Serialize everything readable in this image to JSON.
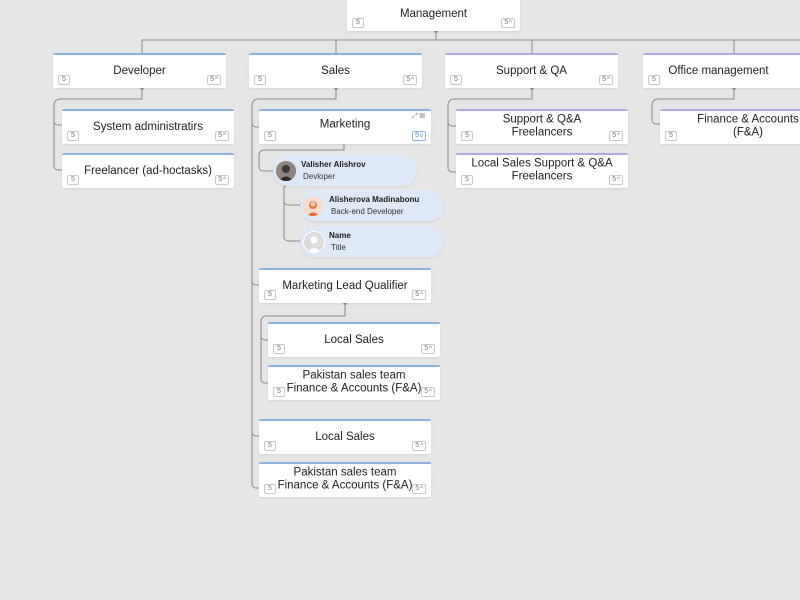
{
  "theme": {
    "connector_color": "#8a8a8a",
    "accent_blue": "#8fb3e0",
    "accent_purple": "#b7a6e0",
    "person_bg": "#dfe8f7"
  },
  "nodes": {
    "management": {
      "label": "Management",
      "count": "5",
      "children": "5"
    },
    "developer": {
      "label": "Developer",
      "count": "5",
      "children": "5"
    },
    "sales": {
      "label": "Sales",
      "count": "5",
      "children": "5"
    },
    "support_qa": {
      "label": "Support & QA",
      "count": "5",
      "children": "5"
    },
    "office_mgmt": {
      "label": "Office management",
      "count": "5",
      "children": "5"
    },
    "sys_admin": {
      "label": "System administratirs",
      "count": "5",
      "children": "5"
    },
    "freelancer": {
      "label": "Freelancer (ad-hoctasks)",
      "count": "5",
      "children": "5"
    },
    "marketing": {
      "label": "Marketing",
      "count": "5",
      "children": "5"
    },
    "support_qa_freelancers": {
      "label": "Support & Q&A\nFreelancers",
      "count": "5",
      "children": "5"
    },
    "local_sales_support": {
      "label": "Local Sales Support & Q&A\nFreelancers",
      "count": "5",
      "children": "5"
    },
    "finance_accounts": {
      "label": "Finance & Accounts\n(F&A)",
      "count": "5"
    },
    "mlq": {
      "label": "Marketing Lead Qualifier",
      "count": "5",
      "children": "5"
    },
    "local_sales_1": {
      "label": "Local Sales",
      "count": "5",
      "children": "5"
    },
    "pakistan_1": {
      "label": "Pakistan sales team\nFinance & Accounts (F&A)",
      "count": "5",
      "children": "5"
    },
    "local_sales_2": {
      "label": "Local Sales",
      "count": "5",
      "children": "5"
    },
    "pakistan_2": {
      "label": "Pakistan sales team\nFinance & Accounts (F&A)",
      "count": "5",
      "children": "5"
    }
  },
  "people": [
    {
      "name": "Valisher Alishrov",
      "title": "Devloper",
      "avatar": "photo-avatar"
    },
    {
      "name": "Alisherova Madinabonu",
      "title": "Back-end Developer",
      "avatar": "illustrated-avatar"
    },
    {
      "name": "Name",
      "title": "Title",
      "avatar": "placeholder-avatar"
    }
  ]
}
